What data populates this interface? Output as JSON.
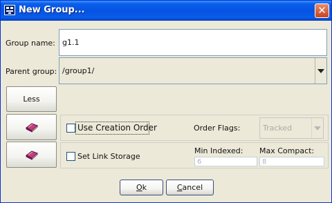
{
  "window": {
    "title": "New Group...",
    "close_glyph": "✕",
    "accent": "#0a5fea"
  },
  "form": {
    "group_name_label": "Group name:",
    "group_name_value": "g1.1",
    "parent_group_label": "Parent group:",
    "parent_group_value": "/group1/"
  },
  "side_buttons": {
    "less_label": "Less",
    "icon_1": "book-icon",
    "icon_2": "book-icon"
  },
  "creation_order": {
    "checkbox_label": "Use Creation Order",
    "checked": false,
    "order_flags_label": "Order Flags:",
    "order_flags_value": "Tracked"
  },
  "link_storage": {
    "checkbox_label": "Set Link Storage",
    "checked": false,
    "min_indexed_label": "Min Indexed:",
    "min_indexed_value": "6",
    "max_compact_label": "Max Compact:",
    "max_compact_value": "8"
  },
  "actions": {
    "ok_mnemonic": "O",
    "ok_rest": "k",
    "cancel_mnemonic": "C",
    "cancel_rest": "ancel"
  }
}
